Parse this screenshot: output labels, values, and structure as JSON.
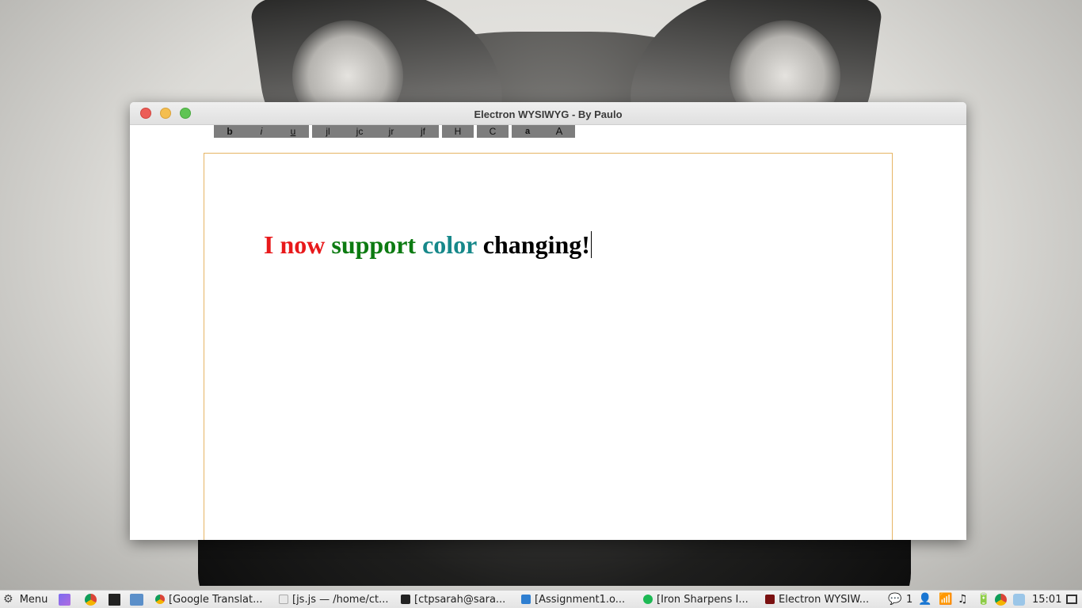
{
  "window": {
    "title": "Electron WYSIWYG - By Paulo"
  },
  "toolbar": {
    "buttons": [
      {
        "label": "b"
      },
      {
        "label": "i"
      },
      {
        "label": "u"
      },
      {
        "label": "jl"
      },
      {
        "label": "jc"
      },
      {
        "label": "jr"
      },
      {
        "label": "jf"
      },
      {
        "label": "H"
      },
      {
        "label": "C"
      },
      {
        "label": "a"
      },
      {
        "label": "A"
      }
    ]
  },
  "editor": {
    "segments": [
      {
        "text": "I now ",
        "color": "#e8191b"
      },
      {
        "text": "support ",
        "color": "#0d7b12"
      },
      {
        "text": "color ",
        "color": "#16888a"
      },
      {
        "text": "changing!",
        "color": "#000000"
      }
    ]
  },
  "taskbar": {
    "menu_label": "Menu",
    "tasks": [
      {
        "label": "[Google Translat..."
      },
      {
        "label": "[js.js — /home/ct..."
      },
      {
        "label": "[ctpsarah@sara..."
      },
      {
        "label": "[Assignment1.o..."
      },
      {
        "label": "[Iron Sharpens I..."
      },
      {
        "label": "Electron WYSIW..."
      }
    ],
    "notification_count": "1",
    "clock": "15:01"
  }
}
